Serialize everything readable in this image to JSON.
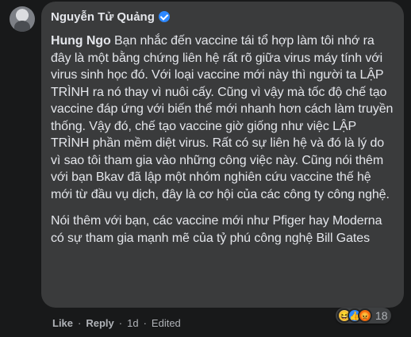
{
  "comment": {
    "author": "Nguyễn Tử Quảng",
    "mention": "Hung Ngo",
    "paragraph1": " Bạn nhắc đến vaccine tái tổ hợp làm tôi nhớ ra đây là một bằng chứng liên hệ rất rõ giữa virus máy tính với virus sinh học đó. Với loại vaccine mới này thì người ta LẬP TRÌNH ra nó thay vì nuôi cấy. Cũng vì vậy mà tốc độ chế tạo vaccine đáp ứng với biến thể mới nhanh hơn cách làm truyền thống. Vậy đó, chế tạo vaccine giờ giống như việc LẬP TRÌNH phần mềm diệt virus. Rất có sự liên hệ và đó là lý do vì sao tôi tham gia vào những công việc này. Cũng nói thêm với bạn Bkav đã lập một nhóm nghiên cứu vaccine thế hệ mới từ đầu vụ dịch, đây là cơ hội của các công ty công nghệ.",
    "paragraph2": "Nói thêm với bạn, các vaccine mới như Pfiger hay Moderna có sự tham gia mạnh mẽ của tỷ phú công nghệ Bill Gates"
  },
  "actions": {
    "like": "Like",
    "reply": "Reply",
    "time": "1d",
    "edited": "Edited"
  },
  "reactions": {
    "icons": [
      "haha-icon",
      "like-icon",
      "angry-icon"
    ],
    "count": "18"
  },
  "colors": {
    "background": "#18191a",
    "bubble": "#3a3b3c",
    "text": "#e4e6eb",
    "secondary": "#b0b3b8",
    "verified": "#2d88ff"
  }
}
